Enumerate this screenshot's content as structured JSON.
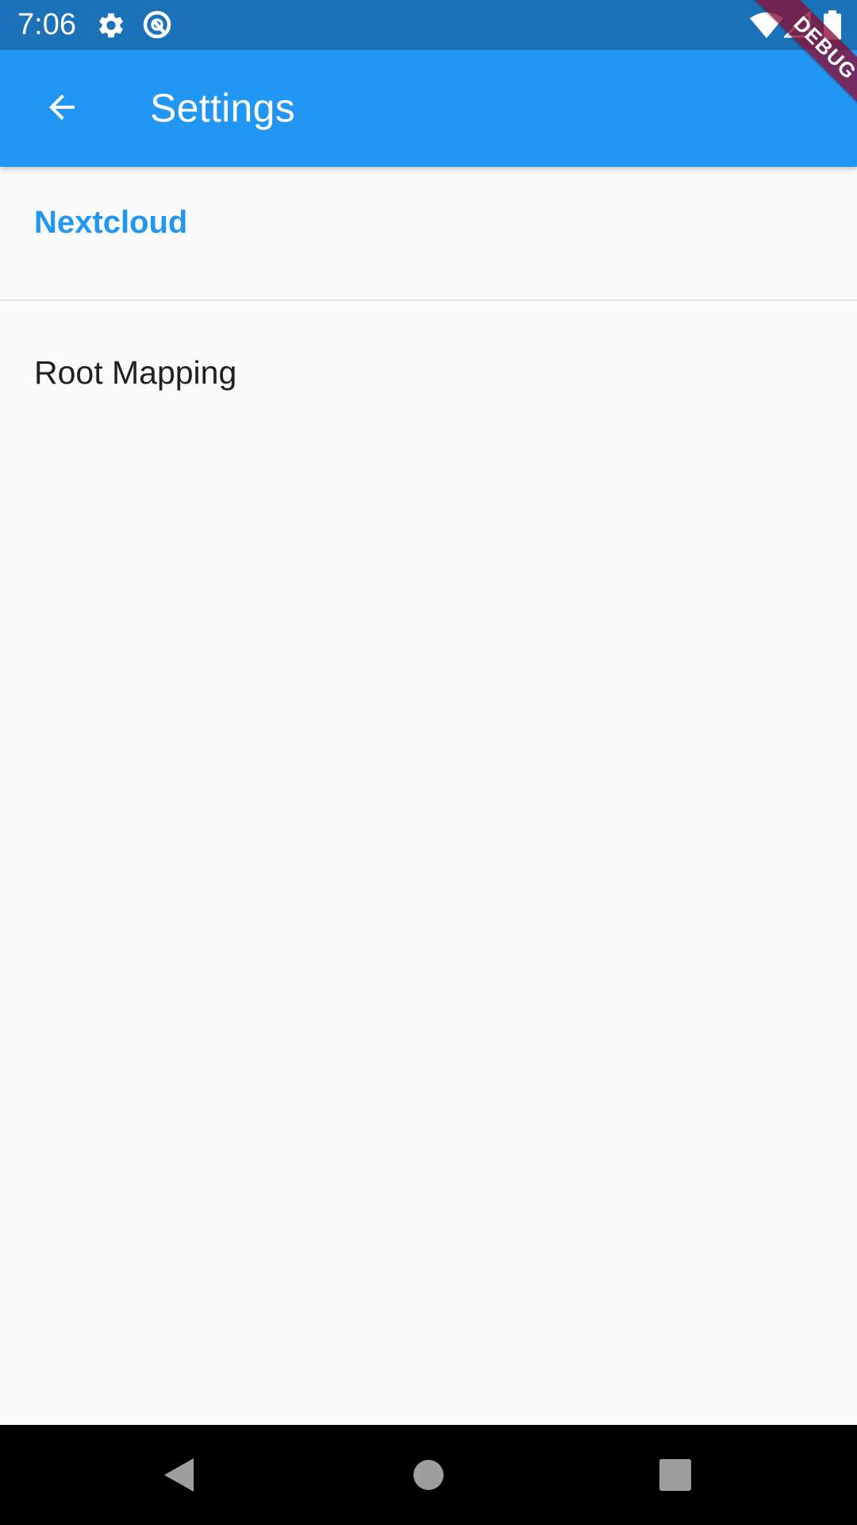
{
  "status_bar": {
    "time": "7:06",
    "icons": [
      "gear-icon",
      "data-saver-icon",
      "wifi-icon",
      "signal-icon",
      "battery-icon"
    ],
    "background": "#1b72b8"
  },
  "app_bar": {
    "title": "Settings",
    "back_icon": "arrow-back-icon",
    "background": "#2196f3"
  },
  "debug_banner": {
    "label": "DEBUG"
  },
  "settings": {
    "section_title": "Nextcloud",
    "section_color": "#2196f3",
    "items": [
      {
        "title": "Root Mapping"
      }
    ]
  },
  "nav_bar": {
    "buttons": [
      "back-triangle-icon",
      "home-circle-icon",
      "recents-square-icon"
    ]
  }
}
